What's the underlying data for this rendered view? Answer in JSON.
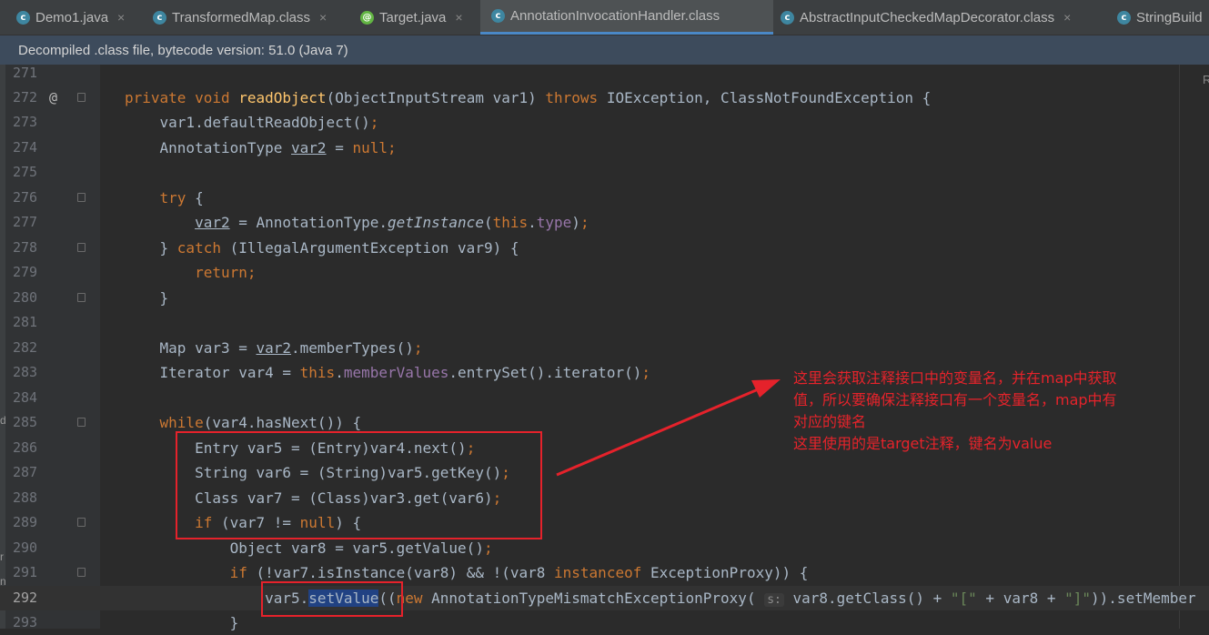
{
  "tabs": [
    {
      "label": "Demo1.java",
      "icon": "class-icon",
      "active": false
    },
    {
      "label": "TransformedMap.class",
      "icon": "class-icon",
      "active": false
    },
    {
      "label": "Target.java",
      "icon": "annotation-icon",
      "active": false
    },
    {
      "label": "AnnotationInvocationHandler.class",
      "icon": "class-icon",
      "active": true
    },
    {
      "label": "AbstractInputCheckedMapDecorator.class",
      "icon": "class-icon",
      "active": false
    },
    {
      "label": "StringBuild",
      "icon": "class-icon",
      "active": false
    }
  ],
  "tab_close_glyph": "×",
  "banner": "Decompiled .class file, bytecode version: 51.0 (Java 7)",
  "gutter_marker": "@",
  "param_hint": "s:",
  "line_numbers": [
    "271",
    "272",
    "273",
    "274",
    "275",
    "276",
    "277",
    "278",
    "279",
    "280",
    "281",
    "282",
    "283",
    "284",
    "285",
    "286",
    "287",
    "288",
    "289",
    "290",
    "291",
    "292",
    "293"
  ],
  "annotation_note": [
    "这里会获取注释接口中的变量名，并在map中获取",
    "值，所以要确保注释接口有一个变量名，map中有",
    "对应的键名",
    "这里使用的是target注释，键名为value"
  ],
  "right_label": "R",
  "side_glyphs": [
    "d",
    "r",
    "n"
  ],
  "colors": {
    "keyword": "#cc7832",
    "function": "#ffc66d",
    "field": "#9876aa",
    "string": "#6a8759",
    "annotation": "#e6232b"
  }
}
